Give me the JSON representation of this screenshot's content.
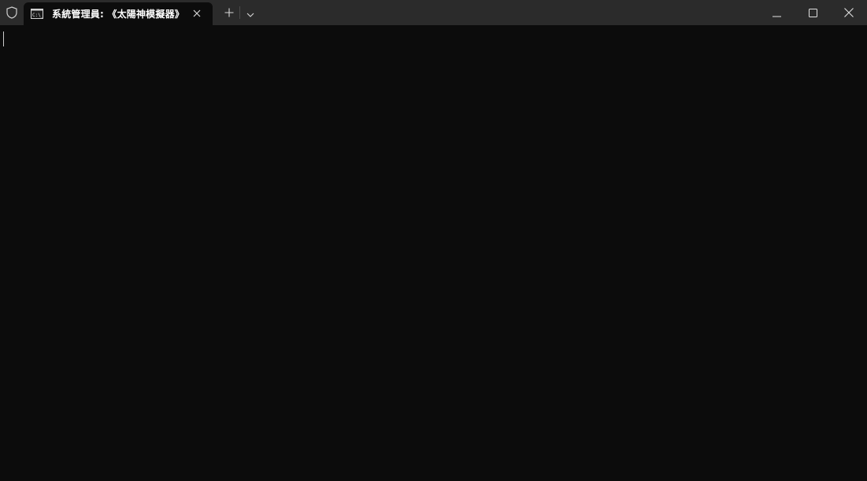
{
  "tab": {
    "title": "系統管理員: 《太陽神模擬器》",
    "icon": "command-prompt-icon"
  },
  "toolbar": {
    "new_tab_icon": "plus-icon",
    "dropdown_icon": "chevron-down-icon"
  },
  "window_controls": {
    "minimize_icon": "minimize-icon",
    "maximize_icon": "maximize-icon",
    "close_icon": "close-icon"
  },
  "colors": {
    "titlebar": "#2b2b2b",
    "terminal_bg": "#0c0c0c",
    "tab_text": "#ffffff"
  }
}
